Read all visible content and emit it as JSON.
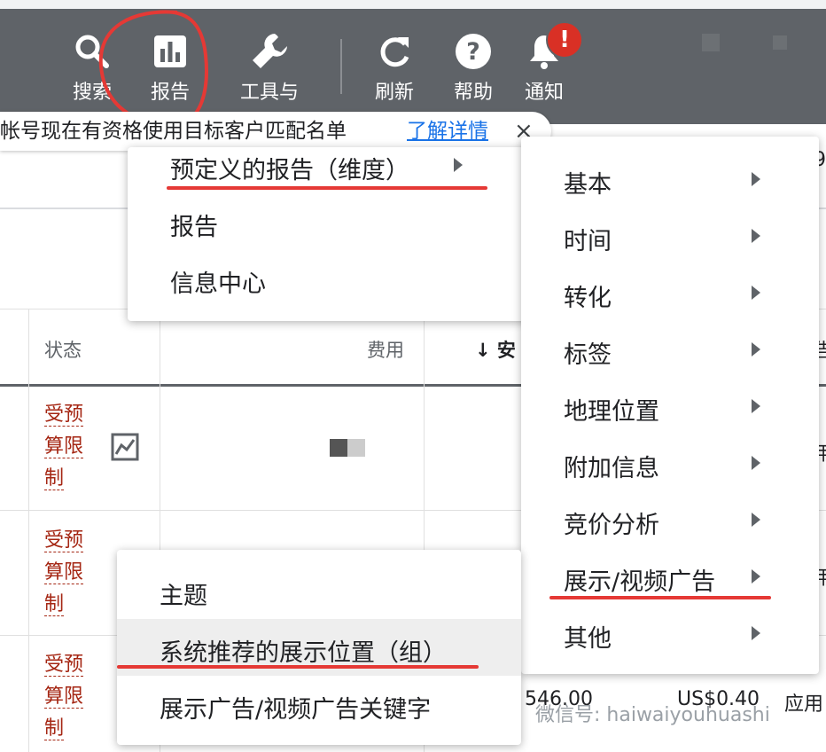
{
  "toolbar": {
    "items": [
      {
        "label": "搜索",
        "icon": "search-icon"
      },
      {
        "label": "报告",
        "icon": "bar-chart-icon"
      },
      {
        "label": "工具与",
        "icon": "wrench-icon"
      },
      {
        "label": "刷新",
        "icon": "refresh-icon"
      },
      {
        "label": "帮助",
        "icon": "help-icon"
      },
      {
        "label": "通知",
        "icon": "bell-icon"
      }
    ],
    "notification_badge": "!"
  },
  "banner": {
    "message": "帐号现在有资格使用目标客户匹配名单",
    "link": "了解详情",
    "close": "×"
  },
  "right_fragment": "9",
  "table": {
    "headers": {
      "status": "状态",
      "cost": "费用",
      "sort_col": "↓ 安"
    },
    "rows": [
      {
        "status": [
          "受预",
          "算限",
          "制"
        ]
      },
      {
        "status": [
          "受预",
          "算限",
          "制"
        ]
      },
      {
        "status": [
          "受预",
          "算限",
          "制"
        ],
        "cost": "546.00",
        "price": "US$0.40",
        "extra": "应用"
      }
    ],
    "edge_fragments": [
      "告",
      "用",
      "用"
    ]
  },
  "reports_menu": {
    "items": [
      {
        "label": "预定义的报告（维度）",
        "has_submenu": true
      },
      {
        "label": "报告",
        "has_submenu": false
      },
      {
        "label": "信息中心",
        "has_submenu": false
      }
    ]
  },
  "dimension_menu": {
    "items": [
      {
        "label": "基本"
      },
      {
        "label": "时间"
      },
      {
        "label": "转化"
      },
      {
        "label": "标签"
      },
      {
        "label": "地理位置"
      },
      {
        "label": "附加信息"
      },
      {
        "label": "竞价分析"
      },
      {
        "label": "展示/视频广告"
      },
      {
        "label": "其他"
      }
    ]
  },
  "display_menu": {
    "items": [
      {
        "label": "主题"
      },
      {
        "label": "系统推荐的展示位置（组）"
      },
      {
        "label": "展示广告/视频广告关键字"
      }
    ]
  },
  "watermark": "微信号: haiwaiyouhuashi",
  "colors": {
    "toolbar": "#5f6368",
    "status_red": "#a52714",
    "link_blue": "#1a73e8",
    "annotation_red": "#e53935"
  }
}
